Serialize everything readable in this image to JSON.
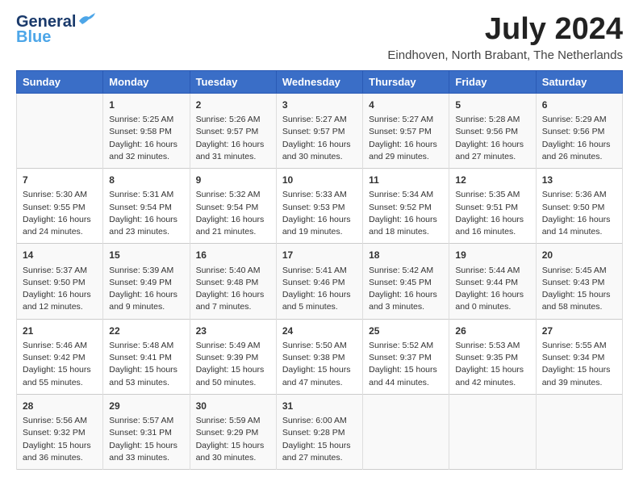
{
  "header": {
    "logo_general": "General",
    "logo_blue": "Blue",
    "month_title": "July 2024",
    "subtitle": "Eindhoven, North Brabant, The Netherlands"
  },
  "days_of_week": [
    "Sunday",
    "Monday",
    "Tuesday",
    "Wednesday",
    "Thursday",
    "Friday",
    "Saturday"
  ],
  "weeks": [
    [
      {
        "day": "",
        "content": ""
      },
      {
        "day": "1",
        "content": "Sunrise: 5:25 AM\nSunset: 9:58 PM\nDaylight: 16 hours\nand 32 minutes."
      },
      {
        "day": "2",
        "content": "Sunrise: 5:26 AM\nSunset: 9:57 PM\nDaylight: 16 hours\nand 31 minutes."
      },
      {
        "day": "3",
        "content": "Sunrise: 5:27 AM\nSunset: 9:57 PM\nDaylight: 16 hours\nand 30 minutes."
      },
      {
        "day": "4",
        "content": "Sunrise: 5:27 AM\nSunset: 9:57 PM\nDaylight: 16 hours\nand 29 minutes."
      },
      {
        "day": "5",
        "content": "Sunrise: 5:28 AM\nSunset: 9:56 PM\nDaylight: 16 hours\nand 27 minutes."
      },
      {
        "day": "6",
        "content": "Sunrise: 5:29 AM\nSunset: 9:56 PM\nDaylight: 16 hours\nand 26 minutes."
      }
    ],
    [
      {
        "day": "7",
        "content": "Sunrise: 5:30 AM\nSunset: 9:55 PM\nDaylight: 16 hours\nand 24 minutes."
      },
      {
        "day": "8",
        "content": "Sunrise: 5:31 AM\nSunset: 9:54 PM\nDaylight: 16 hours\nand 23 minutes."
      },
      {
        "day": "9",
        "content": "Sunrise: 5:32 AM\nSunset: 9:54 PM\nDaylight: 16 hours\nand 21 minutes."
      },
      {
        "day": "10",
        "content": "Sunrise: 5:33 AM\nSunset: 9:53 PM\nDaylight: 16 hours\nand 19 minutes."
      },
      {
        "day": "11",
        "content": "Sunrise: 5:34 AM\nSunset: 9:52 PM\nDaylight: 16 hours\nand 18 minutes."
      },
      {
        "day": "12",
        "content": "Sunrise: 5:35 AM\nSunset: 9:51 PM\nDaylight: 16 hours\nand 16 minutes."
      },
      {
        "day": "13",
        "content": "Sunrise: 5:36 AM\nSunset: 9:50 PM\nDaylight: 16 hours\nand 14 minutes."
      }
    ],
    [
      {
        "day": "14",
        "content": "Sunrise: 5:37 AM\nSunset: 9:50 PM\nDaylight: 16 hours\nand 12 minutes."
      },
      {
        "day": "15",
        "content": "Sunrise: 5:39 AM\nSunset: 9:49 PM\nDaylight: 16 hours\nand 9 minutes."
      },
      {
        "day": "16",
        "content": "Sunrise: 5:40 AM\nSunset: 9:48 PM\nDaylight: 16 hours\nand 7 minutes."
      },
      {
        "day": "17",
        "content": "Sunrise: 5:41 AM\nSunset: 9:46 PM\nDaylight: 16 hours\nand 5 minutes."
      },
      {
        "day": "18",
        "content": "Sunrise: 5:42 AM\nSunset: 9:45 PM\nDaylight: 16 hours\nand 3 minutes."
      },
      {
        "day": "19",
        "content": "Sunrise: 5:44 AM\nSunset: 9:44 PM\nDaylight: 16 hours\nand 0 minutes."
      },
      {
        "day": "20",
        "content": "Sunrise: 5:45 AM\nSunset: 9:43 PM\nDaylight: 15 hours\nand 58 minutes."
      }
    ],
    [
      {
        "day": "21",
        "content": "Sunrise: 5:46 AM\nSunset: 9:42 PM\nDaylight: 15 hours\nand 55 minutes."
      },
      {
        "day": "22",
        "content": "Sunrise: 5:48 AM\nSunset: 9:41 PM\nDaylight: 15 hours\nand 53 minutes."
      },
      {
        "day": "23",
        "content": "Sunrise: 5:49 AM\nSunset: 9:39 PM\nDaylight: 15 hours\nand 50 minutes."
      },
      {
        "day": "24",
        "content": "Sunrise: 5:50 AM\nSunset: 9:38 PM\nDaylight: 15 hours\nand 47 minutes."
      },
      {
        "day": "25",
        "content": "Sunrise: 5:52 AM\nSunset: 9:37 PM\nDaylight: 15 hours\nand 44 minutes."
      },
      {
        "day": "26",
        "content": "Sunrise: 5:53 AM\nSunset: 9:35 PM\nDaylight: 15 hours\nand 42 minutes."
      },
      {
        "day": "27",
        "content": "Sunrise: 5:55 AM\nSunset: 9:34 PM\nDaylight: 15 hours\nand 39 minutes."
      }
    ],
    [
      {
        "day": "28",
        "content": "Sunrise: 5:56 AM\nSunset: 9:32 PM\nDaylight: 15 hours\nand 36 minutes."
      },
      {
        "day": "29",
        "content": "Sunrise: 5:57 AM\nSunset: 9:31 PM\nDaylight: 15 hours\nand 33 minutes."
      },
      {
        "day": "30",
        "content": "Sunrise: 5:59 AM\nSunset: 9:29 PM\nDaylight: 15 hours\nand 30 minutes."
      },
      {
        "day": "31",
        "content": "Sunrise: 6:00 AM\nSunset: 9:28 PM\nDaylight: 15 hours\nand 27 minutes."
      },
      {
        "day": "",
        "content": ""
      },
      {
        "day": "",
        "content": ""
      },
      {
        "day": "",
        "content": ""
      }
    ]
  ]
}
